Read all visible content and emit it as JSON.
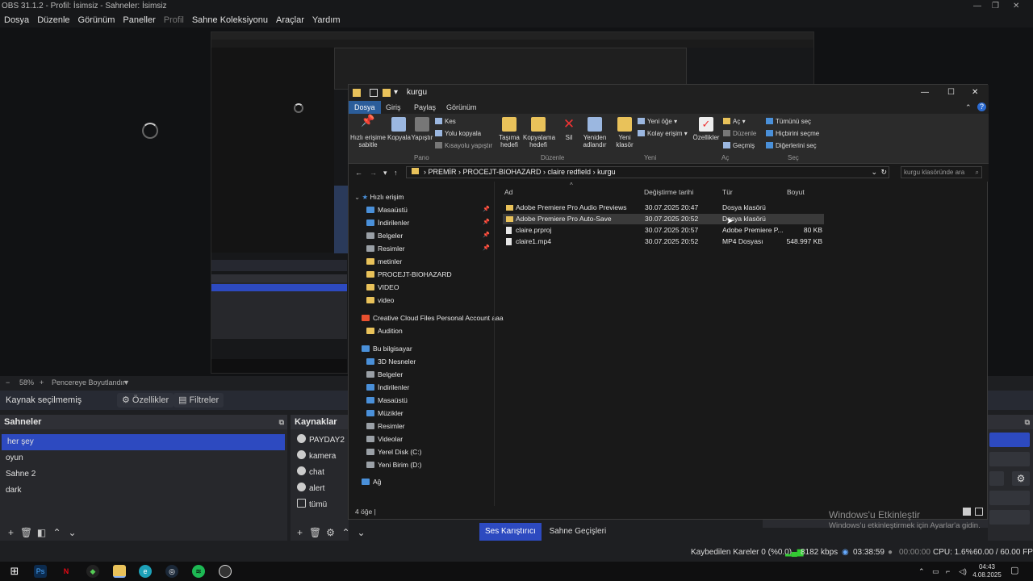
{
  "obs": {
    "window_title": "OBS 31.1.2 - Profil: İsimsiz - Sahneler: İsimsiz",
    "menu": [
      "Dosya",
      "Düzenle",
      "Görünüm",
      "Paneller",
      "Profil",
      "Sahne Koleksiyonu",
      "Araçlar",
      "Yardım"
    ],
    "menu_disabled_index": 4,
    "zoom": "58%",
    "zoom_mode": "Pencereye Boyutlandır",
    "source_status": "Kaynak seçilmemiş",
    "properties_label": "Özellikler",
    "filters_label": "Filtreler",
    "scenes_title": "Sahneler",
    "scenes": [
      "her şey",
      "oyun",
      "Sahne 2",
      "dark"
    ],
    "selected_scene_index": 0,
    "sources_title": "Kaynaklar",
    "sources": [
      "PAYDAY2",
      "kamera",
      "chat",
      "alert",
      "tümü"
    ],
    "mixer_tab": "Ses Karıştırıcı",
    "transitions_tab": "Sahne Geçişleri",
    "status": {
      "dropped": "Kaybedilen Kareler 0 (%0.0)",
      "bitrate": "8182 kbps",
      "rec_time": "03:38:59",
      "stream_time": "00:00:00",
      "cpu": "CPU: 1.6%",
      "fps": "60.00 / 60.00 FPS"
    }
  },
  "explorer": {
    "title": "kurgu",
    "tabs": [
      "Dosya",
      "Giriş",
      "Paylaş",
      "Görünüm"
    ],
    "active_tab_index": 0,
    "ribbon": {
      "pin": "Hızlı erişime sabitle",
      "copy": "Kopyala",
      "paste": "Yapıştır",
      "cut": "Kes",
      "copy_path": "Yolu kopyala",
      "paste_shortcut": "Kısayolu yapıştır",
      "group_clipboard": "Pano",
      "move_to": "Taşıma hedefi",
      "copy_to": "Kopyalama hedefi",
      "delete": "Sil",
      "rename": "Yeniden adlandır",
      "group_organize": "Düzenle",
      "new_folder": "Yeni klasör",
      "new_item": "Yeni öğe",
      "easy_access": "Kolay erişim",
      "group_new": "Yeni",
      "properties": "Özellikler",
      "open": "Aç",
      "edit": "Düzenle",
      "history": "Geçmiş",
      "group_open": "Aç",
      "select_all": "Tümünü seç",
      "select_none": "Hiçbirini seçme",
      "invert": "Diğerlerini seç",
      "group_select": "Seç"
    },
    "breadcrumb": [
      "PREMİR",
      "PROCEJT-BIOHAZARD",
      "claire redfield",
      "kurgu"
    ],
    "search_placeholder": "kurgu klasöründe ara",
    "nav": {
      "quick_access": "Hızlı erişim",
      "quick_items": [
        "Masaüstü",
        "İndirilenler",
        "Belgeler",
        "Resimler",
        "metinler",
        "PROCEJT-BIOHAZARD",
        "VIDEO",
        "video"
      ],
      "creative_cloud": "Creative Cloud Files Personal Account aaa",
      "cc_items": [
        "Audition"
      ],
      "this_pc": "Bu bilgisayar",
      "pc_items": [
        "3D Nesneler",
        "Belgeler",
        "İndirilenler",
        "Masaüstü",
        "Müzikler",
        "Resimler",
        "Videolar",
        "Yerel Disk (C:)",
        "Yeni Birim (D:)"
      ],
      "network": "Ağ"
    },
    "columns": [
      "Ad",
      "Değiştirme tarihi",
      "Tür",
      "Boyut"
    ],
    "files": [
      {
        "name": "Adobe Premiere Pro Audio Previews",
        "date": "30.07.2025 20:47",
        "type": "Dosya klasörü",
        "size": "",
        "kind": "folder"
      },
      {
        "name": "Adobe Premiere Pro Auto-Save",
        "date": "30.07.2025 20:52",
        "type": "Dosya klasörü",
        "size": "",
        "kind": "folder"
      },
      {
        "name": "claire.prproj",
        "date": "30.07.2025 20:57",
        "type": "Adobe Premiere P...",
        "size": "80 KB",
        "kind": "file"
      },
      {
        "name": "claire1.mp4",
        "date": "30.07.2025 20:52",
        "type": "MP4 Dosyası",
        "size": "548.997 KB",
        "kind": "file"
      }
    ],
    "hovered_file_index": 1,
    "item_count": "4 öğe"
  },
  "watermark": {
    "title": "Windows'u Etkinleştir",
    "subtitle": "Windows'u etkinleştirmek için Ayarlar'a gidin."
  },
  "taskbar": {
    "time": "04:43",
    "date": "4.08.2025"
  },
  "colors": {
    "selection": "#2d4ac0",
    "ribbon_tab": "#2b5d9a",
    "folder": "#e9c25a"
  }
}
